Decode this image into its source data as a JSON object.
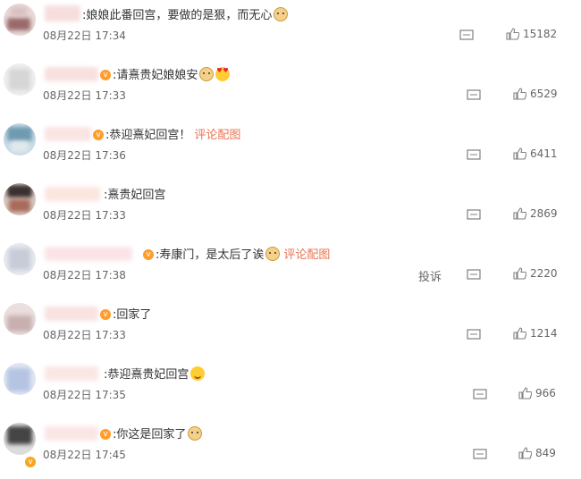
{
  "comments": [
    {
      "text": "娘娘此番回宫，要做的是狠，而无心",
      "emoji": "doge",
      "link": "",
      "time": "08月22日 17:34",
      "likes": "15182",
      "report": ""
    },
    {
      "text": "请熹贵妃娘娘安",
      "emoji": "doge",
      "emoji2": "love",
      "link": "",
      "time": "08月22日 17:33",
      "likes": "6529",
      "report": ""
    },
    {
      "text": "恭迎熹妃回宫！",
      "emoji": "",
      "link": "评论配图",
      "time": "08月22日 17:36",
      "likes": "6411",
      "report": ""
    },
    {
      "text": "熹贵妃回宫",
      "emoji": "",
      "link": "",
      "time": "08月22日 17:33",
      "likes": "2869",
      "report": ""
    },
    {
      "text": "寿康门，是太后了诶",
      "emoji": "doge",
      "link": "评论配图",
      "time": "08月22日 17:38",
      "likes": "2220",
      "report": "投诉"
    },
    {
      "text": "回家了",
      "emoji": "",
      "link": "",
      "time": "08月22日 17:33",
      "likes": "1214",
      "report": ""
    },
    {
      "text": "恭迎熹贵妃回宫",
      "emoji": "wink",
      "link": "",
      "time": "08月22日 17:35",
      "likes": "966",
      "report": ""
    },
    {
      "text": "你这是回家了",
      "emoji": "doge",
      "link": "",
      "time": "08月22日 17:45",
      "likes": "849",
      "report": ""
    }
  ],
  "icons": {
    "reply": "comment-icon",
    "like": "thumbs-up-icon",
    "vip": "vip-badge-icon"
  },
  "colors": {
    "link": "#eb7350",
    "text": "#333333",
    "meta": "#666666"
  }
}
